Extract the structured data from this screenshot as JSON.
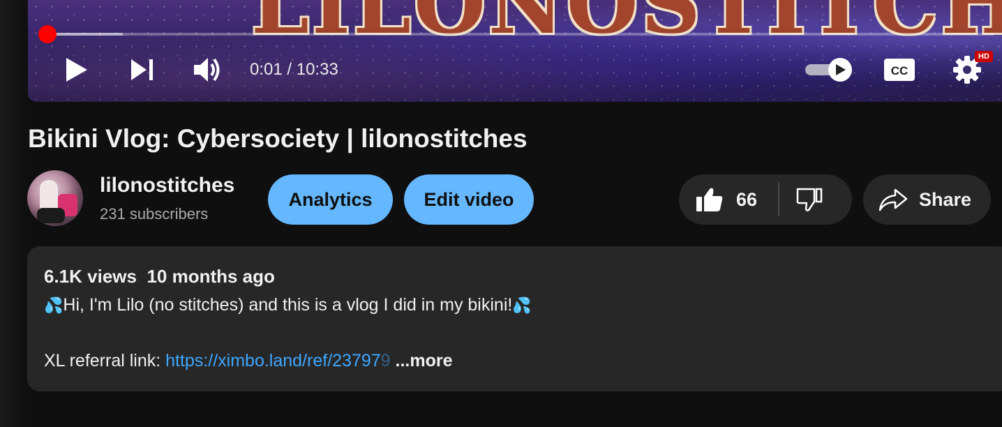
{
  "player": {
    "banner_text": "LILONOSTITCHES",
    "time_current": "0:01",
    "time_separator": " / ",
    "time_total": "10:33",
    "progress_fraction": 0.002,
    "autoplay_on": true,
    "quality_badge": "HD",
    "cc_label": "CC",
    "colors": {
      "progress": "#ff0000"
    }
  },
  "video": {
    "title": "Bikini Vlog: Cybersociety | lilonostitches"
  },
  "channel": {
    "name": "lilonostitches",
    "subscribers": "231 subscribers"
  },
  "actions": {
    "analytics_label": "Analytics",
    "edit_label": "Edit video",
    "like_count": "66",
    "share_label": "Share",
    "colors": {
      "primary_button": "#65b8ff",
      "pill_bg": "#272727"
    }
  },
  "description": {
    "views": "6.1K views",
    "age": "10 months ago",
    "line1_emoji_left": "💦",
    "line1_text": "Hi, I'm Lilo (no stitches) and this is a vlog I did in my bikini!",
    "line1_emoji_right": "💦",
    "referral_label": "XL referral link: ",
    "referral_link_visible": "https://ximbo.land/ref/23797",
    "referral_link_faded": "9",
    "more_label": " ...more",
    "colors": {
      "link": "#3ea6ff"
    }
  },
  "icons": [
    "play-icon",
    "next-icon",
    "volume-icon",
    "autoplay-toggle-icon",
    "cc-icon",
    "gear-icon",
    "thumbs-up-icon",
    "thumbs-down-icon",
    "share-arrow-icon"
  ]
}
